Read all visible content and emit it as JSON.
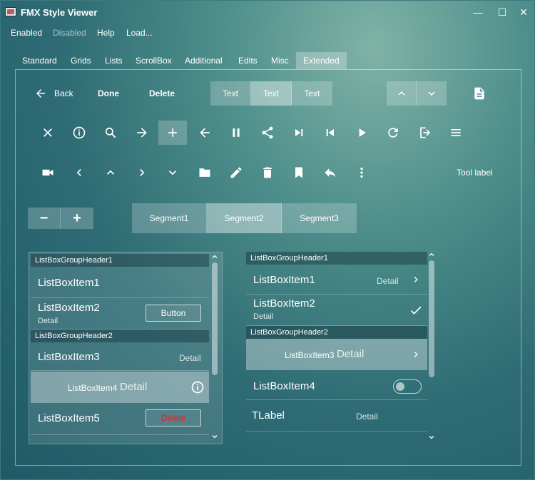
{
  "window": {
    "title": "FMX Style Viewer",
    "controls": {
      "minimize": "—",
      "maximize": "☐",
      "close": "✕"
    }
  },
  "menu": [
    "Enabled",
    "Disabled",
    "Help",
    "Load..."
  ],
  "tabs": [
    "Standard",
    "Grids",
    "Lists",
    "ScrollBox",
    "Additional",
    "Edits",
    "Misc",
    "Extended"
  ],
  "active_tab": "Extended",
  "toolbar1": {
    "back_label": "Back",
    "done_label": "Done",
    "delete_label": "Delete",
    "segments": [
      "Text",
      "Text",
      "Text"
    ],
    "active_segment": 1
  },
  "toolbar2": {
    "icons": [
      "close-icon",
      "info-icon",
      "search-icon",
      "arrow-right-icon",
      "add-icon",
      "arrow-left-icon",
      "pause-icon",
      "share-icon",
      "skip-next-icon",
      "skip-previous-icon",
      "play-icon",
      "refresh-icon",
      "exit-icon",
      "menu-icon"
    ]
  },
  "toolbar3": {
    "icons": [
      "camera-icon",
      "chevron-left-icon",
      "chevron-up-icon",
      "chevron-right-icon",
      "chevron-down-icon",
      "folder-icon",
      "pencil-icon",
      "trash-icon",
      "bookmark-icon",
      "reply-icon",
      "more-vertical-icon"
    ],
    "tool_label": "Tool label"
  },
  "stepper": {
    "minus": "−",
    "plus": "+"
  },
  "segments": [
    "Segment1",
    "Segment2",
    "Segment3"
  ],
  "active_segment": 1,
  "listbox_left": {
    "header1": "ListBoxGroupHeader1",
    "item1": "ListBoxItem1",
    "item2": {
      "text": "ListBoxItem2",
      "sub": "Detail",
      "button": "Button"
    },
    "header2": "ListBoxGroupHeader2",
    "item3": {
      "text": "ListBoxItem3",
      "detail": "Detail"
    },
    "item4": {
      "text": "ListBoxItem4",
      "detail": "Detail"
    },
    "item5": {
      "text": "ListBoxItem5",
      "button": "Delete"
    }
  },
  "listbox_right": {
    "header1": "ListBoxGroupHeader1",
    "item1": {
      "text": "ListBoxItem1",
      "detail": "Detail"
    },
    "item2": {
      "text": "ListBoxItem2",
      "sub": "Detail"
    },
    "header2": "ListBoxGroupHeader2",
    "item3": {
      "text": "ListBoxItem3",
      "detail": "Detail"
    },
    "item4": {
      "text": "ListBoxItem4"
    },
    "item5": {
      "text": "TLabel",
      "detail": "Detail"
    }
  },
  "colors": {
    "delete_text": "#e02020",
    "accent": "#ffffff"
  }
}
